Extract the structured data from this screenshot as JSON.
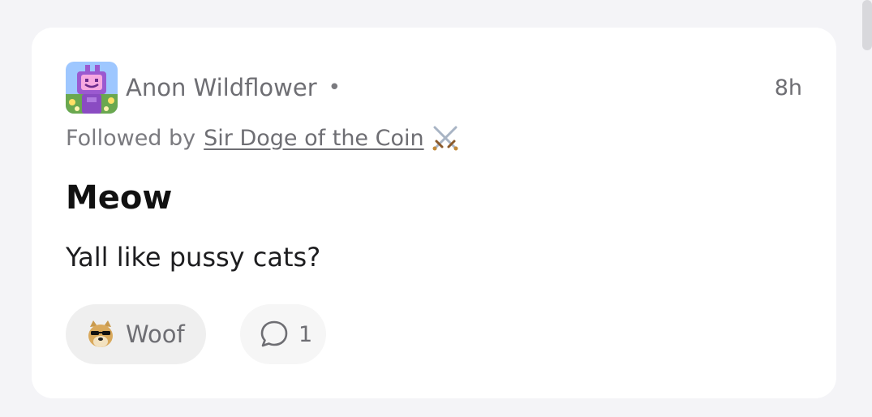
{
  "post": {
    "author": "Anon Wildflower",
    "separator": "•",
    "time": "8h",
    "followed_prefix": "Followed by",
    "followed_by_name": "Sir Doge of the Coin",
    "title": "Meow",
    "body": "Yall like pussy cats?",
    "reaction_label": "Woof",
    "comment_count": "1"
  },
  "icons": {
    "avatar": "robot-avatar",
    "followed_badge": "crossed-swords-icon",
    "reaction": "doge-sunglasses-icon",
    "comment": "speech-bubble-icon"
  },
  "colors": {
    "background": "#f4f4f7",
    "card": "#ffffff",
    "muted_text": "#6e6e73",
    "title_text": "#111111",
    "pill": "#efefef"
  }
}
